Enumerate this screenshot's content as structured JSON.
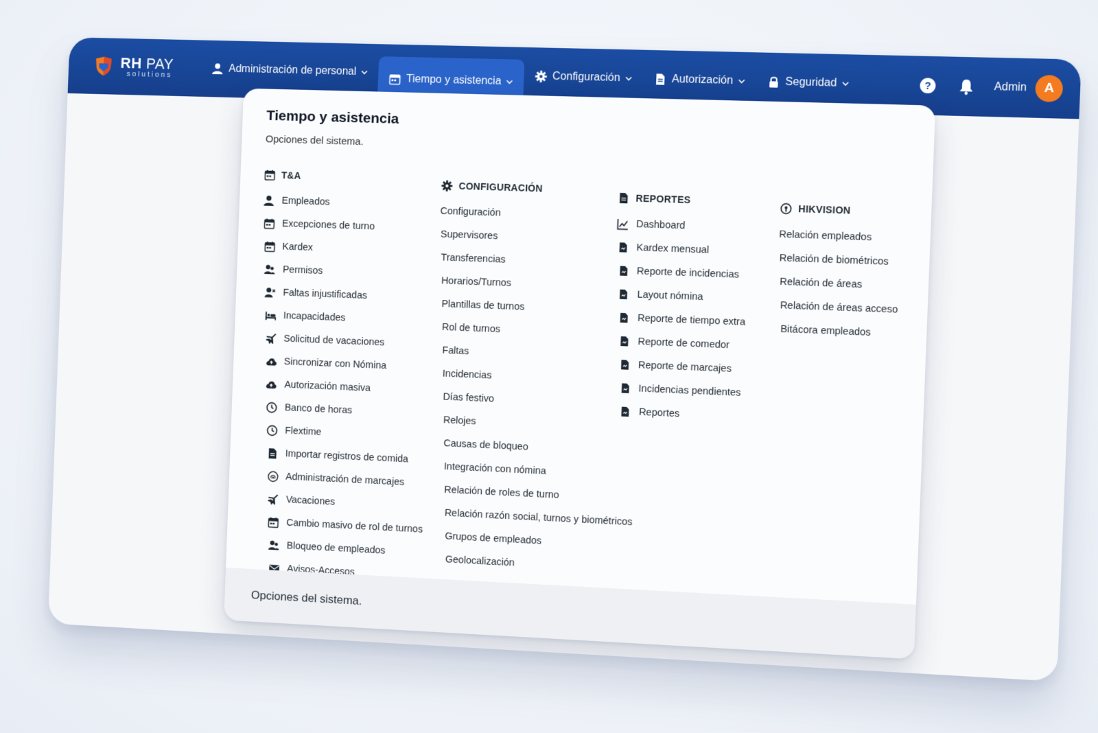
{
  "brand": {
    "name_bold": "RH",
    "name_light": "PAY",
    "sub": "solutions"
  },
  "nav": {
    "items": [
      {
        "label": "Administración de personal",
        "icon": "user-icon"
      },
      {
        "label": "Tiempo y asistencia",
        "icon": "calendar-icon",
        "active": true
      },
      {
        "label": "Configuración",
        "icon": "gear-icon"
      },
      {
        "label": "Autorización",
        "icon": "document-icon"
      },
      {
        "label": "Seguridad",
        "icon": "lock-icon"
      }
    ]
  },
  "user": {
    "name": "Admin",
    "initial": "A"
  },
  "panel": {
    "title": "Tiempo y asistencia",
    "subtitle": "Opciones del sistema.",
    "footer": "Opciones del sistema.",
    "columns": [
      {
        "heading": "T&A",
        "icon": "calendar-icon",
        "items": [
          {
            "label": "Empleados",
            "icon": "user-icon"
          },
          {
            "label": "Excepciones de turno",
            "icon": "calendar-icon"
          },
          {
            "label": "Kardex",
            "icon": "calendar-icon"
          },
          {
            "label": "Permisos",
            "icon": "users-icon"
          },
          {
            "label": "Faltas injustificadas",
            "icon": "user-x-icon"
          },
          {
            "label": "Incapacidades",
            "icon": "bed-icon"
          },
          {
            "label": "Solicitud de vacaciones",
            "icon": "plane-icon"
          },
          {
            "label": "Sincronizar con Nómina",
            "icon": "cloud-icon"
          },
          {
            "label": "Autorización masiva",
            "icon": "cloud-icon"
          },
          {
            "label": "Banco de horas",
            "icon": "clock-icon"
          },
          {
            "label": "Flextime",
            "icon": "clock-icon"
          },
          {
            "label": "Importar registros de comida",
            "icon": "document-icon"
          },
          {
            "label": "Administración de marcajes",
            "icon": "fingerprint-icon"
          },
          {
            "label": "Vacaciones",
            "icon": "plane-icon"
          },
          {
            "label": "Cambio masivo de rol de turnos",
            "icon": "calendar-icon"
          },
          {
            "label": "Bloqueo de empleados",
            "icon": "users-icon"
          },
          {
            "label": "Avisos-Accesos",
            "icon": "envelope-icon"
          }
        ]
      },
      {
        "heading": "CONFIGURACIÓN",
        "icon": "gear-icon",
        "items": [
          {
            "label": "Configuración"
          },
          {
            "label": "Supervisores"
          },
          {
            "label": "Transferencias"
          },
          {
            "label": "Horarios/Turnos"
          },
          {
            "label": "Plantillas de turnos"
          },
          {
            "label": "Rol de turnos"
          },
          {
            "label": "Faltas"
          },
          {
            "label": "Incidencias"
          },
          {
            "label": "Días festivo"
          },
          {
            "label": "Relojes"
          },
          {
            "label": "Causas de bloqueo"
          },
          {
            "label": "Integración con nómina"
          },
          {
            "label": "Relación de roles de turno"
          },
          {
            "label": "Relación razón social, turnos y biométricos"
          },
          {
            "label": "Grupos de empleados"
          },
          {
            "label": "Geolocalización"
          }
        ]
      },
      {
        "heading": "REPORTES",
        "icon": "document-icon",
        "items": [
          {
            "label": "Dashboard",
            "icon": "chart-icon"
          },
          {
            "label": "Kardex mensual",
            "icon": "file-icon"
          },
          {
            "label": "Reporte de incidencias",
            "icon": "file-icon"
          },
          {
            "label": "Layout nómina",
            "icon": "file-icon"
          },
          {
            "label": "Reporte de tiempo extra",
            "icon": "file-icon"
          },
          {
            "label": "Reporte de comedor",
            "icon": "file-icon"
          },
          {
            "label": "Reporte de marcajes",
            "icon": "file-icon"
          },
          {
            "label": "Incidencias pendientes",
            "icon": "file-icon"
          },
          {
            "label": "Reportes",
            "icon": "file-icon"
          }
        ]
      },
      {
        "heading": "HIKVISION",
        "icon": "hikvision-icon",
        "items": [
          {
            "label": "Relación empleados"
          },
          {
            "label": "Relación de biométricos"
          },
          {
            "label": "Relación de áreas"
          },
          {
            "label": "Relación de áreas acceso"
          },
          {
            "label": "Bitácora empleados"
          }
        ]
      }
    ]
  },
  "colors": {
    "nav_bg": "#1b4da3",
    "nav_active": "#2a63c9",
    "avatar": "#f47b20",
    "text": "#1f2933"
  }
}
